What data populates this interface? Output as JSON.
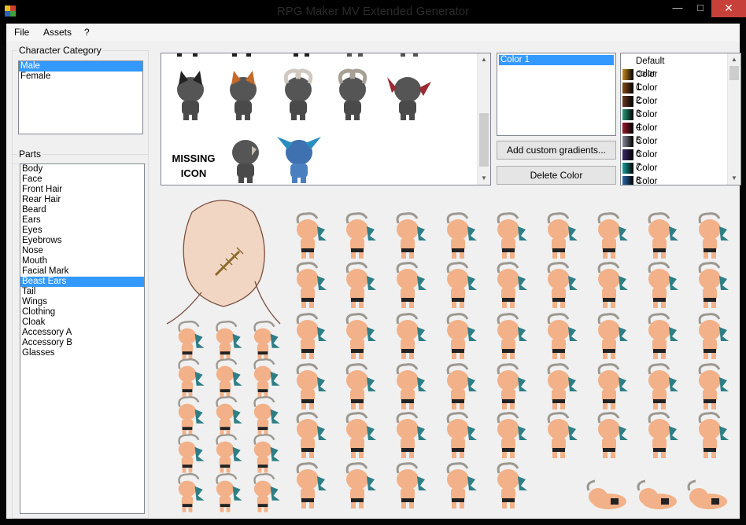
{
  "window": {
    "title": "RPG Maker MV Extended Generator",
    "minimize_glyph": "—",
    "maximize_glyph": "□",
    "close_glyph": "✕"
  },
  "menu": {
    "items": [
      "File",
      "Assets",
      "?"
    ]
  },
  "character_category": {
    "label": "Character Category",
    "items": [
      "Male",
      "Female"
    ],
    "selected": "Male"
  },
  "parts": {
    "label": "Parts",
    "items": [
      "Body",
      "Face",
      "Front Hair",
      "Rear Hair",
      "Beard",
      "Ears",
      "Eyes",
      "Eyebrows",
      "Nose",
      "Mouth",
      "Facial Mark",
      "Beast Ears",
      "Tail",
      "Wings",
      "Clothing",
      "Cloak",
      "Accessory A",
      "Accessory B",
      "Glasses"
    ],
    "selected": "Beast Ears"
  },
  "icon_gallery": {
    "missing_icon_text": "MISSING ICON",
    "icons": [
      "cat-ears-black",
      "cat-ears-orange",
      "ram-horns-white",
      "ram-horns-grey",
      "bat-wing-ears",
      "goat-ears",
      "fin-ears-blue"
    ]
  },
  "color_list": {
    "items": [
      "Color 1"
    ],
    "selected": "Color 1"
  },
  "buttons": {
    "add_gradients": "Add custom gradients...",
    "delete_color": "Delete Color"
  },
  "gradients": {
    "items": [
      {
        "label": "Default color",
        "color": ""
      },
      {
        "label": "Color 1",
        "color": "#c98a1e"
      },
      {
        "label": "Color 2",
        "color": "#8a4a1a"
      },
      {
        "label": "Color 3",
        "color": "#6b3a24"
      },
      {
        "label": "Color 4",
        "color": "#2a9a7a"
      },
      {
        "label": "Color 5",
        "color": "#9a1a2a"
      },
      {
        "label": "Color 6",
        "color": "#8a8a9a"
      },
      {
        "label": "Color 7",
        "color": "#3a2a6a"
      },
      {
        "label": "Color 8",
        "color": "#1aa0a0"
      },
      {
        "label": "Color 9",
        "color": "#2a6aaa"
      }
    ]
  },
  "preview": {
    "face_mark": "stitched-scar",
    "accent_colors": {
      "skin": "#f2b188",
      "hair": "#2e7e86",
      "horn": "#9c9890",
      "shorts": "#222222"
    }
  }
}
